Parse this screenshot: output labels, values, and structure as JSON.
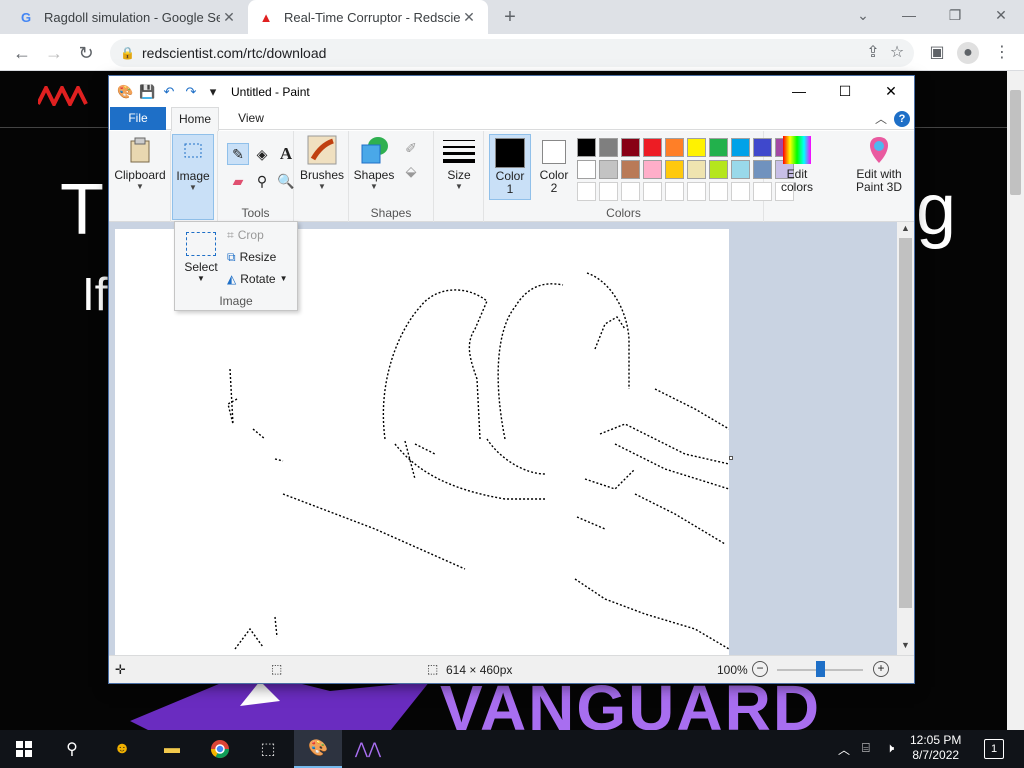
{
  "browser": {
    "tabs": [
      {
        "title": "Ragdoll simulation - Google Sear",
        "favicon": "google-icon",
        "active": false
      },
      {
        "title": "Real-Time Corruptor - Redscient",
        "favicon": "redscientist-icon",
        "active": true
      }
    ],
    "url": "redscientist.com/rtc/download"
  },
  "page": {
    "bg_text_1": "T",
    "bg_text_2": "g",
    "bg_text_3": "If",
    "bottom_text": "VANGUARD"
  },
  "paint": {
    "title": "Untitled - Paint",
    "tabs": {
      "file": "File",
      "home": "Home",
      "view": "View"
    },
    "groups": {
      "clipboard": "Clipboard",
      "image": "Image",
      "tools": "Tools",
      "brushes": "Brushes",
      "shapes_btn": "Shapes",
      "shapes": "Shapes",
      "size": "Size",
      "color1": "Color 1",
      "color2": "Color 2",
      "colors": "Colors",
      "edit_colors": "Edit colors",
      "edit_paint3d": "Edit with Paint 3D"
    },
    "image_menu": {
      "crop": "Crop",
      "resize": "Resize",
      "rotate": "Rotate",
      "select": "Select",
      "group": "Image"
    },
    "palette_row1": [
      "#000000",
      "#7f7f7f",
      "#880015",
      "#ed1c24",
      "#ff7f27",
      "#fff200",
      "#22b14c",
      "#00a2e8",
      "#3f48cc",
      "#a349a4"
    ],
    "palette_row2": [
      "#ffffff",
      "#c3c3c3",
      "#b97a57",
      "#ffaec9",
      "#ffc90e",
      "#efe4b0",
      "#b5e61d",
      "#99d9ea",
      "#7092be",
      "#c8bfe7"
    ],
    "status": {
      "size": "614 × 460px",
      "zoom": "100%"
    }
  },
  "taskbar": {
    "time": "12:05 PM",
    "date": "8/7/2022",
    "notifications": "1"
  }
}
